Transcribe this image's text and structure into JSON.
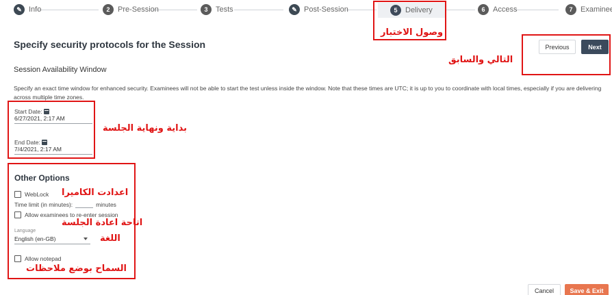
{
  "stepper": {
    "steps": [
      {
        "number": "",
        "label": "Info"
      },
      {
        "number": "2",
        "label": "Pre-Session"
      },
      {
        "number": "3",
        "label": "Tests"
      },
      {
        "number": "",
        "label": "Post-Session"
      },
      {
        "number": "5",
        "label": "Delivery"
      },
      {
        "number": "6",
        "label": "Access"
      },
      {
        "number": "7",
        "label": "Examinees"
      }
    ],
    "active_step": "Delivery"
  },
  "header": {
    "title": "Specify security protocols for the Session",
    "previous_label": "Previous",
    "next_label": "Next"
  },
  "availability": {
    "section_title": "Session Availability Window",
    "description": "Specify an exact time window for enhanced security. Examinees will not be able to start the test unless inside the window. Note that these times are UTC; it is up to you to coordinate with local times, especially if you are delivering across multiple time zones.",
    "start_label": "Start Date:",
    "start_value": "6/27/2021, 2:17 AM",
    "end_label": "End Date:",
    "end_value": "7/4/2021, 2:17 AM"
  },
  "options": {
    "title": "Other Options",
    "weblock_label": "WebLock",
    "time_limit_label": "Time limit (in minutes):",
    "time_limit_value": "",
    "time_limit_unit": "minutes",
    "reenter_label": "Allow examinees to re-enter session",
    "language_label": "Language",
    "language_value": "English (en-GB)",
    "notepad_label": "Allow notepad"
  },
  "footer": {
    "cancel_label": "Cancel",
    "save_label": "Save & Exit"
  },
  "annotations": {
    "delivery": "وصول الاختبار",
    "next_prev": "التالي والسابق",
    "dates": "بداية ونهاية الجلسة",
    "camera": "اعدادت الكاميرا",
    "reenter": "اتاحة اعادة الجلسة",
    "language": "اللغة",
    "notepad": "السماح بوضع ملاحظات"
  },
  "colors": {
    "annotation_red": "#e01414",
    "primary": "#3b4a5c",
    "save_orange": "#e8764f"
  }
}
